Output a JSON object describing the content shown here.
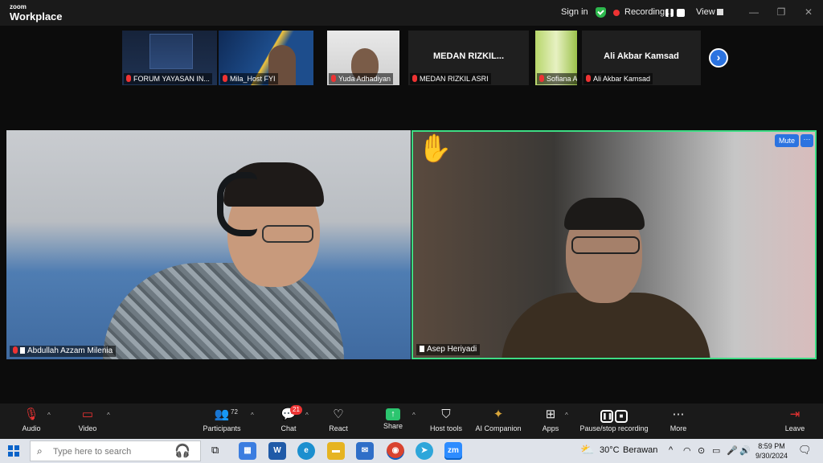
{
  "app": {
    "brand_line1": "zoom",
    "brand_line2": "Workplace"
  },
  "titlebar": {
    "sign_in": "Sign in",
    "recording_label": "Recording...",
    "view_label": "View",
    "accent_color": "#2db84d"
  },
  "thumbnails": [
    {
      "name": "FORUM YAYASAN IN...",
      "big_name": "",
      "muted": true
    },
    {
      "name": "Mila_Host FYI",
      "big_name": "",
      "muted": true
    },
    {
      "name": "Yuda Adhadiyan",
      "big_name": "",
      "muted": true
    },
    {
      "name": "MEDAN RIZKIL ASRI",
      "big_name": "MEDAN RIZKIL...",
      "muted": true
    },
    {
      "name": "Sofiana Anis",
      "big_name": "",
      "muted": true
    },
    {
      "name": "Ali Akbar Kamsad",
      "big_name": "Ali Akbar Kamsad",
      "muted": true
    }
  ],
  "tiles": {
    "left": {
      "name": "Abdullah Azzam Milenia",
      "muted": true
    },
    "right": {
      "name": "Asep Heriyadi",
      "hand_raised": "✋",
      "mute_button": "Mute",
      "more_button": "···",
      "active_speaker_color": "#3ddc84"
    }
  },
  "toolbar": {
    "audio": "Audio",
    "video": "Video",
    "participants": "Participants",
    "participants_count": "72",
    "chat": "Chat",
    "chat_badge": "21",
    "react": "React",
    "share": "Share",
    "host_tools": "Host tools",
    "ai_companion": "AI Companion",
    "apps": "Apps",
    "pause_stop_recording": "Pause/stop recording",
    "more": "More",
    "leave": "Leave"
  },
  "taskbar": {
    "search_placeholder": "Type here to search",
    "weather_temp": "30°C",
    "weather_desc": "Berawan",
    "time": "8:59 PM",
    "date": "9/30/2024"
  }
}
